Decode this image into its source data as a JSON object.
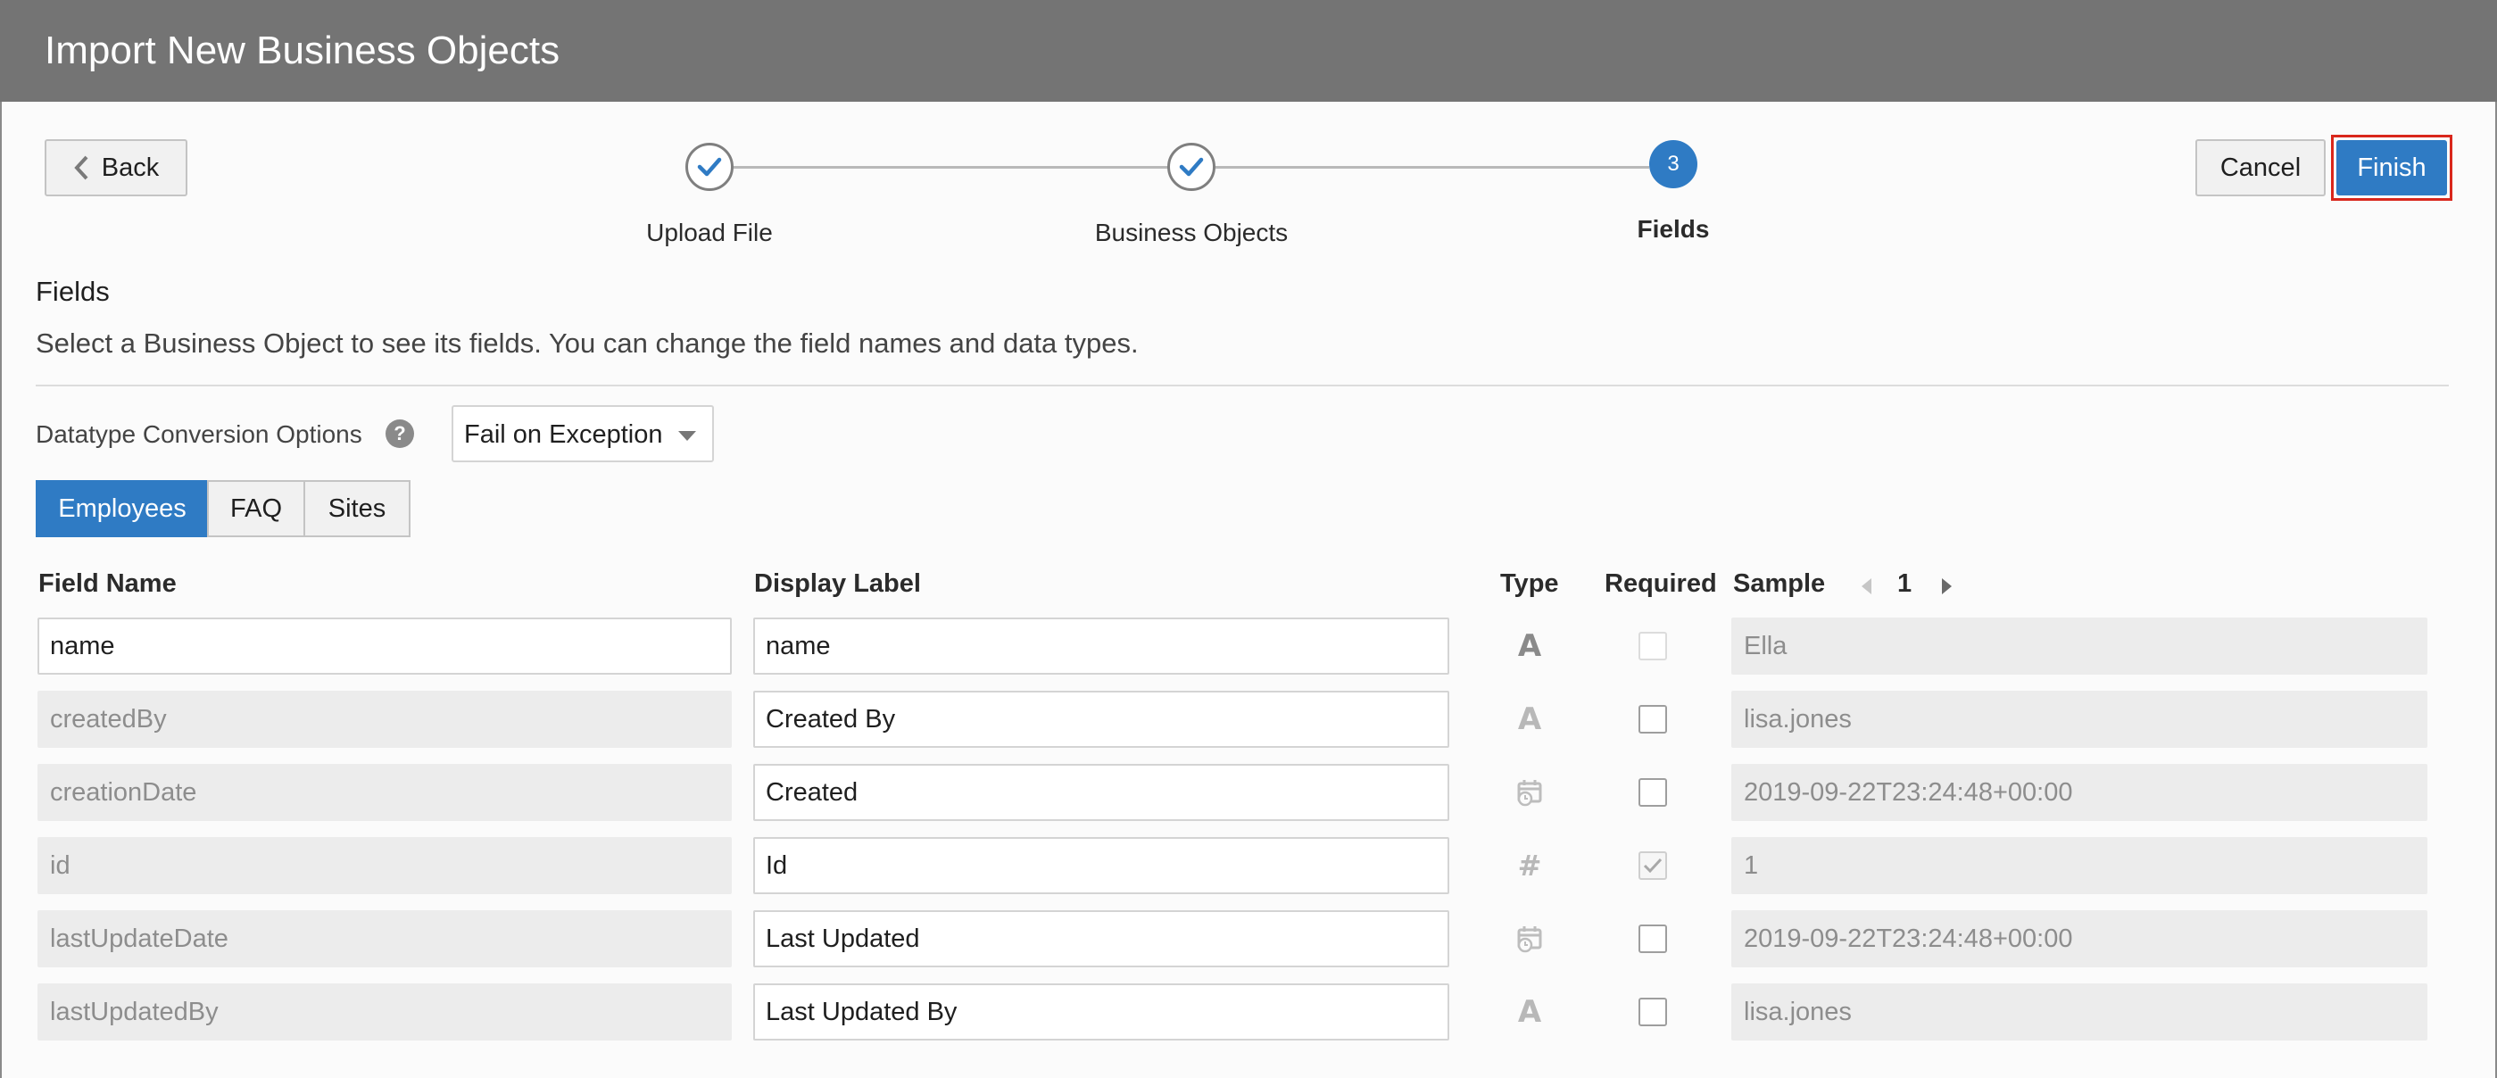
{
  "dialog": {
    "title": "Import New Business Objects"
  },
  "nav": {
    "back": "Back",
    "cancel": "Cancel",
    "finish": "Finish"
  },
  "steps": [
    {
      "label": "Upload File",
      "state": "complete"
    },
    {
      "label": "Business Objects",
      "state": "complete"
    },
    {
      "label": "Fields",
      "number": "3",
      "state": "current"
    }
  ],
  "section": {
    "title": "Fields",
    "description": "Select a Business Object to see its fields. You can change the field names and data types."
  },
  "conversion": {
    "label": "Datatype Conversion Options",
    "help": "?",
    "selected": "Fail on Exception"
  },
  "tabs": [
    {
      "label": "Employees",
      "active": true
    },
    {
      "label": "FAQ",
      "active": false
    },
    {
      "label": "Sites",
      "active": false
    }
  ],
  "table": {
    "headers": {
      "field_name": "Field Name",
      "display_label": "Display Label",
      "type": "Type",
      "required": "Required",
      "sample": "Sample"
    },
    "sample_page": "1",
    "rows": [
      {
        "field_name": "name",
        "display_label": "name",
        "type_icon": "text-type-icon",
        "required": false,
        "sample": "Ella"
      },
      {
        "field_name": "createdBy",
        "display_label": "Created By",
        "type_icon": "text-type-icon",
        "required": false,
        "sample": "lisa.jones"
      },
      {
        "field_name": "creationDate",
        "display_label": "Created",
        "type_icon": "datetime-type-icon",
        "required": false,
        "sample": "2019-09-22T23:24:48+00:00"
      },
      {
        "field_name": "id",
        "display_label": "Id",
        "type_icon": "number-type-icon",
        "required": true,
        "sample": "1"
      },
      {
        "field_name": "lastUpdateDate",
        "display_label": "Last Updated",
        "type_icon": "datetime-type-icon",
        "required": false,
        "sample": "2019-09-22T23:24:48+00:00"
      },
      {
        "field_name": "lastUpdatedBy",
        "display_label": "Last Updated By",
        "type_icon": "text-type-icon",
        "required": false,
        "sample": "lisa.jones"
      }
    ]
  },
  "colors": {
    "accent": "#2f7bc4",
    "header_bg": "#747474",
    "finish_outline": "#d9271c"
  }
}
